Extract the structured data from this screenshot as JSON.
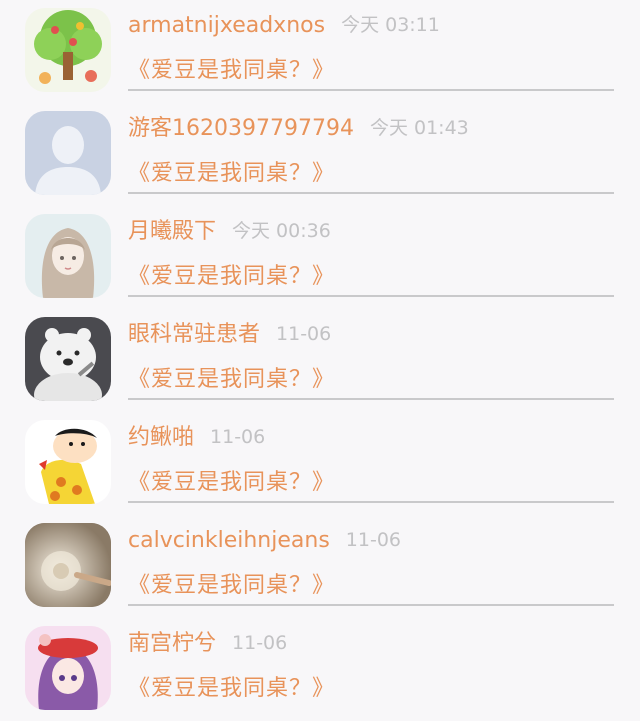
{
  "feed": {
    "items": [
      {
        "user": "armatnijxeadxnos",
        "time": "今天 03:11",
        "title": "《爱豆是我同桌？》",
        "avatar_icon": "cartoon-tree-avatar-icon"
      },
      {
        "user": "游客1620397797794",
        "time": "今天 01:43",
        "title": "《爱豆是我同桌？》",
        "avatar_icon": "default-user-silhouette-icon"
      },
      {
        "user": "月曦殿下",
        "time": "今天 00:36",
        "title": "《爱豆是我同桌？》",
        "avatar_icon": "anime-girl-avatar-icon"
      },
      {
        "user": "眼科常驻患者",
        "time": "11-06",
        "title": "《爱豆是我同桌？》",
        "avatar_icon": "white-bear-avatar-icon"
      },
      {
        "user": "约鳅啪",
        "time": "11-06",
        "title": "《爱豆是我同桌？》",
        "avatar_icon": "cartoon-boy-avatar-icon"
      },
      {
        "user": "calvcinkleihnjeans",
        "time": "11-06",
        "title": "《爱豆是我同桌？》",
        "avatar_icon": "dandelion-photo-avatar-icon"
      },
      {
        "user": "南宫柠兮",
        "time": "11-06",
        "title": "《爱豆是我同桌？》",
        "avatar_icon": "anime-girl-red-hat-avatar-icon"
      }
    ]
  },
  "colors": {
    "accent": "#e8935a",
    "timestamp": "#c2c2c4",
    "divider": "#c9c9cb",
    "background": "#f8f7f9"
  }
}
